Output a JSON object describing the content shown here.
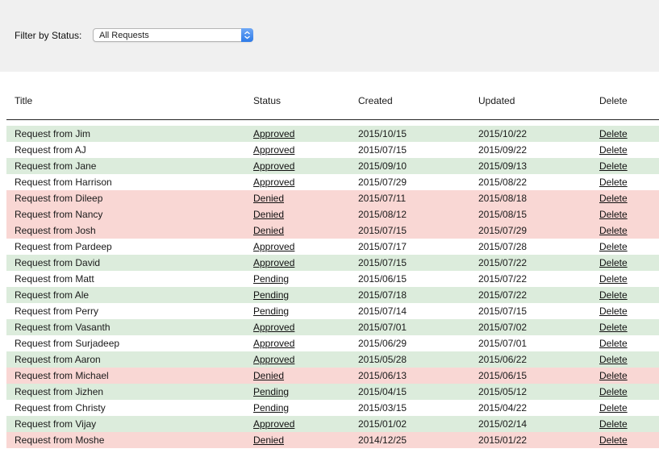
{
  "filter": {
    "label": "Filter by Status:",
    "selected": "All Requests"
  },
  "columns": {
    "title": "Title",
    "status": "Status",
    "created": "Created",
    "updated": "Updated",
    "delete": "Delete"
  },
  "rows": [
    {
      "title": "Request from Jim",
      "status": "Approved",
      "created": "2015/10/15",
      "updated": "2015/10/22",
      "delete": "Delete",
      "highlight": "approved"
    },
    {
      "title": "Request from AJ",
      "status": "Approved",
      "created": "2015/07/15",
      "updated": "2015/09/22",
      "delete": "Delete",
      "highlight": "none"
    },
    {
      "title": "Request from Jane",
      "status": "Approved",
      "created": "2015/09/10",
      "updated": "2015/09/13",
      "delete": "Delete",
      "highlight": "approved"
    },
    {
      "title": "Request from Harrison",
      "status": "Approved",
      "created": "2015/07/29",
      "updated": "2015/08/22",
      "delete": "Delete",
      "highlight": "none"
    },
    {
      "title": "Request from Dileep",
      "status": "Denied",
      "created": "2015/07/11",
      "updated": "2015/08/18",
      "delete": "Delete",
      "highlight": "denied"
    },
    {
      "title": "Request from Nancy",
      "status": "Denied",
      "created": "2015/08/12",
      "updated": "2015/08/15",
      "delete": "Delete",
      "highlight": "denied"
    },
    {
      "title": "Request from Josh",
      "status": "Denied",
      "created": "2015/07/15",
      "updated": "2015/07/29",
      "delete": "Delete",
      "highlight": "denied"
    },
    {
      "title": "Request from Pardeep",
      "status": "Approved",
      "created": "2015/07/17",
      "updated": "2015/07/28",
      "delete": "Delete",
      "highlight": "none"
    },
    {
      "title": "Request from David",
      "status": "Approved",
      "created": "2015/07/15",
      "updated": "2015/07/22",
      "delete": "Delete",
      "highlight": "approved"
    },
    {
      "title": "Request from Matt",
      "status": "Pending",
      "created": "2015/06/15",
      "updated": "2015/07/22",
      "delete": "Delete",
      "highlight": "none"
    },
    {
      "title": "Request from Ale",
      "status": "Pending",
      "created": "2015/07/18",
      "updated": "2015/07/22",
      "delete": "Delete",
      "highlight": "approved"
    },
    {
      "title": "Request from Perry",
      "status": "Pending",
      "created": "2015/07/14",
      "updated": "2015/07/15",
      "delete": "Delete",
      "highlight": "none"
    },
    {
      "title": "Request from Vasanth",
      "status": "Approved",
      "created": "2015/07/01",
      "updated": "2015/07/02",
      "delete": "Delete",
      "highlight": "approved"
    },
    {
      "title": "Request from Surjadeep",
      "status": "Approved",
      "created": "2015/06/29",
      "updated": "2015/07/01",
      "delete": "Delete",
      "highlight": "none"
    },
    {
      "title": "Request from Aaron",
      "status": "Approved",
      "created": "2015/05/28",
      "updated": "2015/06/22",
      "delete": "Delete",
      "highlight": "approved"
    },
    {
      "title": "Request from Michael",
      "status": "Denied",
      "created": "2015/06/13",
      "updated": "2015/06/15",
      "delete": "Delete",
      "highlight": "denied"
    },
    {
      "title": "Request from Jizhen",
      "status": "Pending",
      "created": "2015/04/15",
      "updated": "2015/05/12",
      "delete": "Delete",
      "highlight": "approved"
    },
    {
      "title": "Request from Christy",
      "status": "Pending",
      "created": "2015/03/15",
      "updated": "2015/04/22",
      "delete": "Delete",
      "highlight": "none"
    },
    {
      "title": "Request from Vijay",
      "status": "Approved",
      "created": "2015/01/02",
      "updated": "2015/02/14",
      "delete": "Delete",
      "highlight": "approved"
    },
    {
      "title": "Request from Moshe",
      "status": "Denied",
      "created": "2014/12/25",
      "updated": "2015/01/22",
      "delete": "Delete",
      "highlight": "denied"
    }
  ],
  "colors": {
    "approved_row": "#dcecdc",
    "denied_row": "#f9d7d4",
    "select_accent": "#2d7ae8"
  },
  "icons": {
    "select_arrows": "up-down-chevron-icon"
  }
}
